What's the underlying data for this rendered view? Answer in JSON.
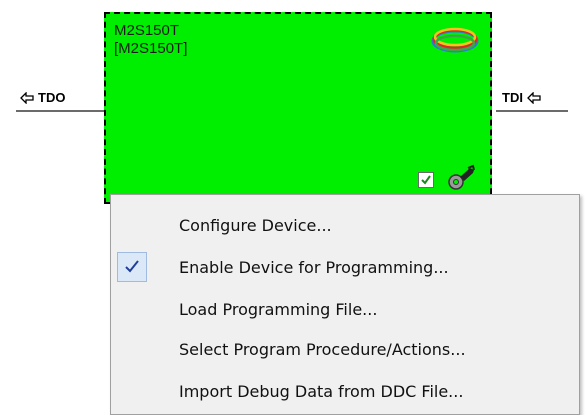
{
  "device": {
    "name_line1": "M2S150T",
    "name_line2": "[M2S150T]",
    "color": "#00ee00",
    "enabled": true
  },
  "ports": {
    "left_label": "TDO",
    "right_label": "TDI"
  },
  "context_menu": {
    "items": [
      {
        "label": "Configure Device...",
        "checked": false
      },
      {
        "label": "Enable Device for Programming...",
        "checked": true
      },
      {
        "label": "Load Programming File...",
        "checked": false
      },
      {
        "label": "Select Program Procedure/Actions...",
        "checked": false
      },
      {
        "label": "Import Debug Data from DDC File...",
        "checked": false
      }
    ]
  },
  "icons": {
    "port_arrow": "arrow-left-outline-icon",
    "logo": "microsemi-logo-icon",
    "checkbox": "checkbox-checked-icon",
    "config": "wrench-icon",
    "menu_check": "checkmark-icon"
  }
}
